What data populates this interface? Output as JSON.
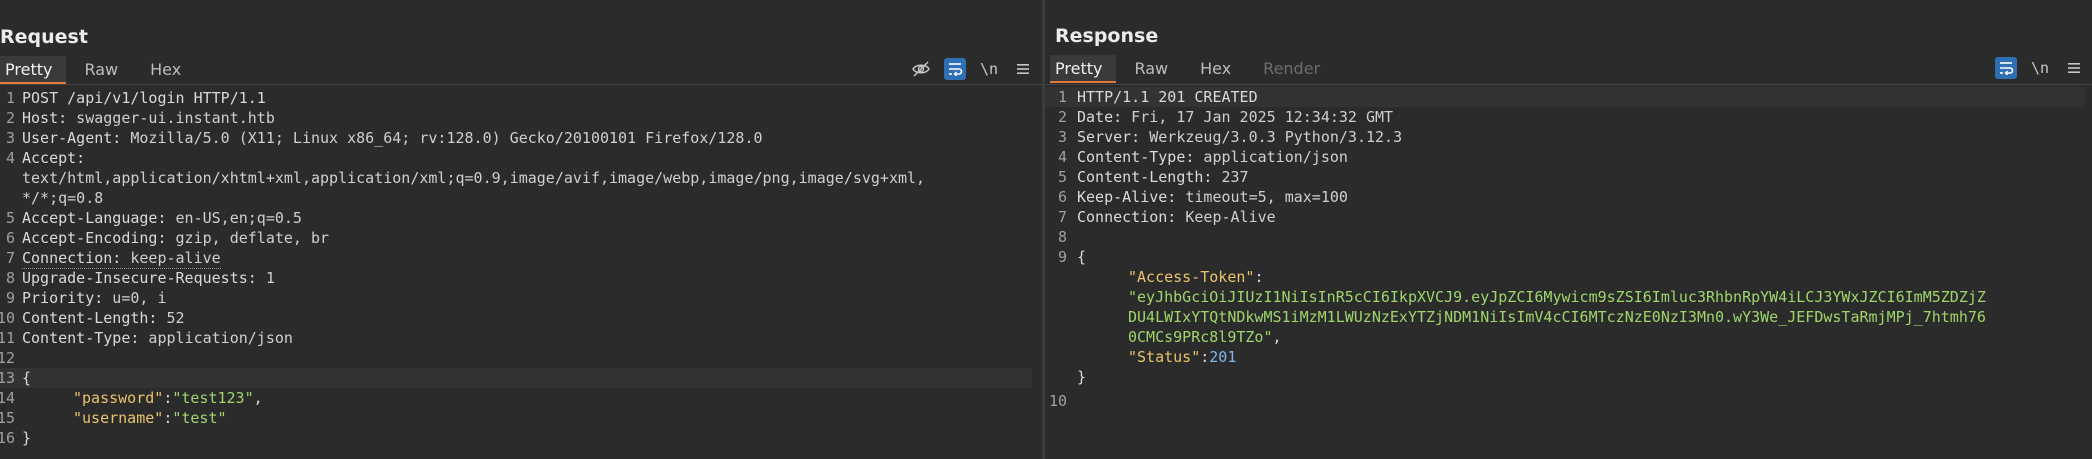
{
  "request": {
    "title": "Request",
    "tabs": [
      "Pretty",
      "Raw",
      "Hex"
    ],
    "active_tab": "Pretty",
    "toolbar": {
      "newline_label": "\\n"
    },
    "lines": [
      {
        "no": "1",
        "name": "",
        "value": "POST /api/v1/login HTTP/1.1"
      },
      {
        "no": "2",
        "name": "Host:",
        "value": " swagger-ui.instant.htb"
      },
      {
        "no": "3",
        "name": "User-Agent:",
        "value": " Mozilla/5.0 (X11; Linux x86_64; rv:128.0) Gecko/20100101 Firefox/128.0"
      },
      {
        "no": "4",
        "name": "Accept:",
        "value": ""
      },
      {
        "no": "",
        "name": "",
        "value": "text/html,application/xhtml+xml,application/xml;q=0.9,image/avif,image/webp,image/png,image/svg+xml,"
      },
      {
        "no": "",
        "name": "",
        "value": "*/*;q=0.8"
      },
      {
        "no": "5",
        "name": "Accept-Language:",
        "value": " en-US,en;q=0.5"
      },
      {
        "no": "6",
        "name": "Accept-Encoding:",
        "value": " gzip, deflate, br"
      },
      {
        "no": "7",
        "name": "Connection:",
        "value": " keep-alive"
      },
      {
        "no": "8",
        "name": "Upgrade-Insecure-Requests:",
        "value": " 1"
      },
      {
        "no": "9",
        "name": "Priority:",
        "value": " u=0, i"
      },
      {
        "no": "10",
        "name": "Content-Length:",
        "value": " 52"
      },
      {
        "no": "11",
        "name": "Content-Type:",
        "value": " application/json"
      },
      {
        "no": "12",
        "name": "",
        "value": ""
      },
      {
        "no": "13",
        "name": "",
        "value": "{"
      },
      {
        "no": "14",
        "name": "",
        "value": ""
      },
      {
        "no": "15",
        "name": "",
        "value": ""
      },
      {
        "no": "16",
        "name": "",
        "value": "}"
      }
    ],
    "json": {
      "password_key": "\"password\"",
      "password_value": "\"test123\"",
      "username_key": "\"username\"",
      "username_value": "\"test\""
    }
  },
  "response": {
    "title": "Response",
    "tabs": [
      "Pretty",
      "Raw",
      "Hex",
      "Render"
    ],
    "active_tab": "Pretty",
    "toolbar": {
      "newline_label": "\\n"
    },
    "lines": [
      {
        "no": "1",
        "name": "",
        "value": "HTTP/1.1 201 CREATED"
      },
      {
        "no": "2",
        "name": "Date:",
        "value": " Fri, 17 Jan 2025 12:34:32 GMT"
      },
      {
        "no": "3",
        "name": "Server:",
        "value": " Werkzeug/3.0.3 Python/3.12.3"
      },
      {
        "no": "4",
        "name": "Content-Type:",
        "value": " application/json"
      },
      {
        "no": "5",
        "name": "Content-Length:",
        "value": " 237"
      },
      {
        "no": "6",
        "name": "Keep-Alive:",
        "value": " timeout=5, max=100"
      },
      {
        "no": "7",
        "name": "Connection:",
        "value": " Keep-Alive"
      },
      {
        "no": "8",
        "name": "",
        "value": ""
      },
      {
        "no": "9",
        "name": "",
        "value": "{"
      }
    ],
    "json": {
      "token_key": "\"Access-Token\"",
      "token_line1": "\"eyJhbGciOiJIUzI1NiIsInR5cCI6IkpXVCJ9.eyJpZCI6Mywicm9sZSI6Imluc3RhbnRpYW4iLCJ3YWxJZCI6ImM5ZDZjZ",
      "token_line2": "DU4LWIxYTQtNDkwMS1iMzM1LWUzNzExYTZjNDM1NiIsImV4cCI6MTczNzE0NzI3Mn0.wY3We_JEFDwsTaRmjMPj_7htmh76",
      "token_line3": "0CMCs9PRc8l9TZo\"",
      "status_key": "\"Status\"",
      "status_value": "201",
      "close_brace": "}",
      "last_line_no": "10"
    }
  }
}
